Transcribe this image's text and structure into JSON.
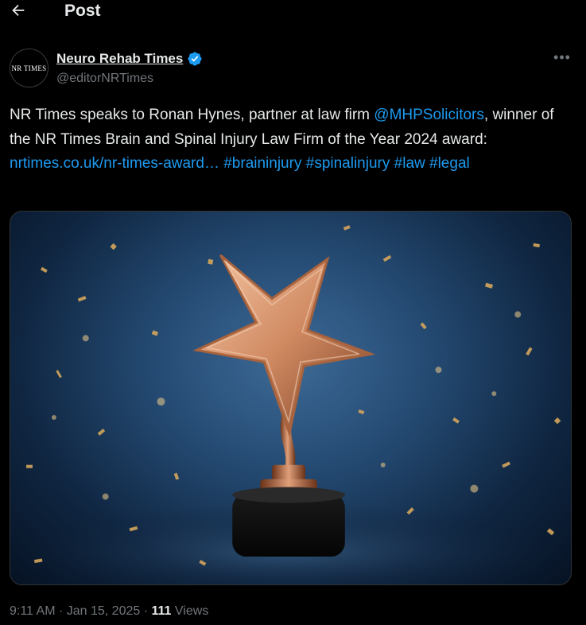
{
  "header": {
    "title": "Post",
    "back_icon": "arrow-left-icon"
  },
  "author": {
    "avatar_text": "NR TIMES",
    "display_name": "Neuro Rehab Times",
    "handle": "@editorNRTimes",
    "verified": true,
    "verified_color": "#1d9bf0"
  },
  "tweet": {
    "text_1": "NR Times speaks to Ronan Hynes, partner at law firm ",
    "mention": "@MHPSolicitors",
    "text_2": ", winner of the NR Times Brain and Spinal Injury Law Firm of  the Year 2024 award: ",
    "link": "nrtimes.co.uk/nr-times-award…",
    "hashtags": [
      "#braininjury",
      "#spinalinjury",
      "#law",
      "#legal"
    ],
    "link_color": "#1d9bf0"
  },
  "media": {
    "description_icon": "award-star-trophy-image"
  },
  "meta": {
    "time": "9:11 AM",
    "separator": "·",
    "date": "Jan 15, 2025",
    "views_count": "111",
    "views_label": "Views"
  }
}
